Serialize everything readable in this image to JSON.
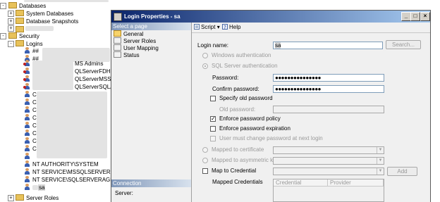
{
  "explorer": {
    "items": [
      {
        "label": "Databases",
        "expander": "-"
      },
      {
        "label": "System Databases",
        "expander": "+"
      },
      {
        "label": "Database Snapshots",
        "expander": "+"
      },
      {
        "label": "Security",
        "expander": "-"
      },
      {
        "label": "Logins",
        "expander": "-"
      }
    ],
    "login_fragments": [
      "##",
      "##",
      "MS Admins",
      "QLServerFDHos",
      "QLServerMSSQ",
      "QLServerSQLA",
      "C",
      "C",
      "C",
      "C",
      "C",
      "C",
      "C",
      "C"
    ],
    "logins_visible": [
      "NT AUTHORITY\\SYSTEM",
      "NT SERVICE\\MSSQLSERVER",
      "NT SERVICE\\SQLSERVERAGENT",
      "sa"
    ],
    "bottom_item": "Server Roles"
  },
  "dialog": {
    "title": "Login Properties - sa",
    "caption_buttons": {
      "minimize": "_",
      "maximize": "□",
      "close": "×"
    }
  },
  "sidebar": {
    "header": "Select a page",
    "pages": [
      "General",
      "Server Roles",
      "User Mapping",
      "Status"
    ],
    "connection_header": "Connection",
    "server_label": "Server:"
  },
  "toolbar": {
    "script": "Script",
    "help": "Help"
  },
  "form": {
    "login_name_label": "Login name:",
    "login_name_value": "sa",
    "search_button": "Search...",
    "windows_auth": "Windows authentication",
    "sql_auth": "SQL Server authentication",
    "password_label": "Password:",
    "password_value": "●●●●●●●●●●●●●●●",
    "confirm_label": "Confirm password:",
    "confirm_value": "●●●●●●●●●●●●●●●",
    "specify_old": "Specify old password",
    "old_password_label": "Old password:",
    "enforce_policy": "Enforce password policy",
    "enforce_policy_checked": true,
    "enforce_expiration": "Enforce password expiration",
    "must_change": "User must change password at next login",
    "mapped_cert": "Mapped to certificate",
    "mapped_asym": "Mapped to asymmetric key",
    "map_credential": "Map to Credential",
    "add_button": "Add",
    "mapped_credentials_label": "Mapped Credentials",
    "grid_headers": [
      "Credential",
      "Provider"
    ]
  }
}
